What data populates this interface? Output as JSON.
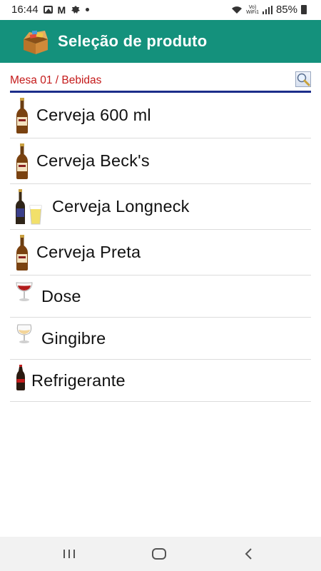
{
  "status_bar": {
    "time": "16:44",
    "volte": [
      "Vo)",
      "WiFi1"
    ],
    "battery": "85%"
  },
  "app_bar": {
    "title": "Seleção de produto",
    "logo_icon": "open-box-icon"
  },
  "header": {
    "breadcrumb": "Mesa 01 / Bebidas",
    "search_icon": "magnifier-icon"
  },
  "products": [
    {
      "label": "Cerveja 600 ml",
      "icon": "beer-bottle-icon"
    },
    {
      "label": "Cerveja Beck's",
      "icon": "beer-bottle-icon"
    },
    {
      "label": "Cerveja Longneck",
      "icon": "longneck-and-glass-icon"
    },
    {
      "label": "Cerveja Preta",
      "icon": "beer-bottle-icon"
    },
    {
      "label": "Dose",
      "icon": "wine-glass-icon"
    },
    {
      "label": "Gingibre",
      "icon": "snifter-glass-icon"
    },
    {
      "label": "Refrigerante",
      "icon": "soda-bottle-icon"
    }
  ],
  "nav_bar": {
    "recents_icon": "recents-icon",
    "home_icon": "home-icon",
    "back_icon": "back-icon"
  },
  "colors": {
    "app_bar": "#14917c",
    "breadcrumb": "#c41a1a",
    "header_rule": "#1c2d8a"
  }
}
